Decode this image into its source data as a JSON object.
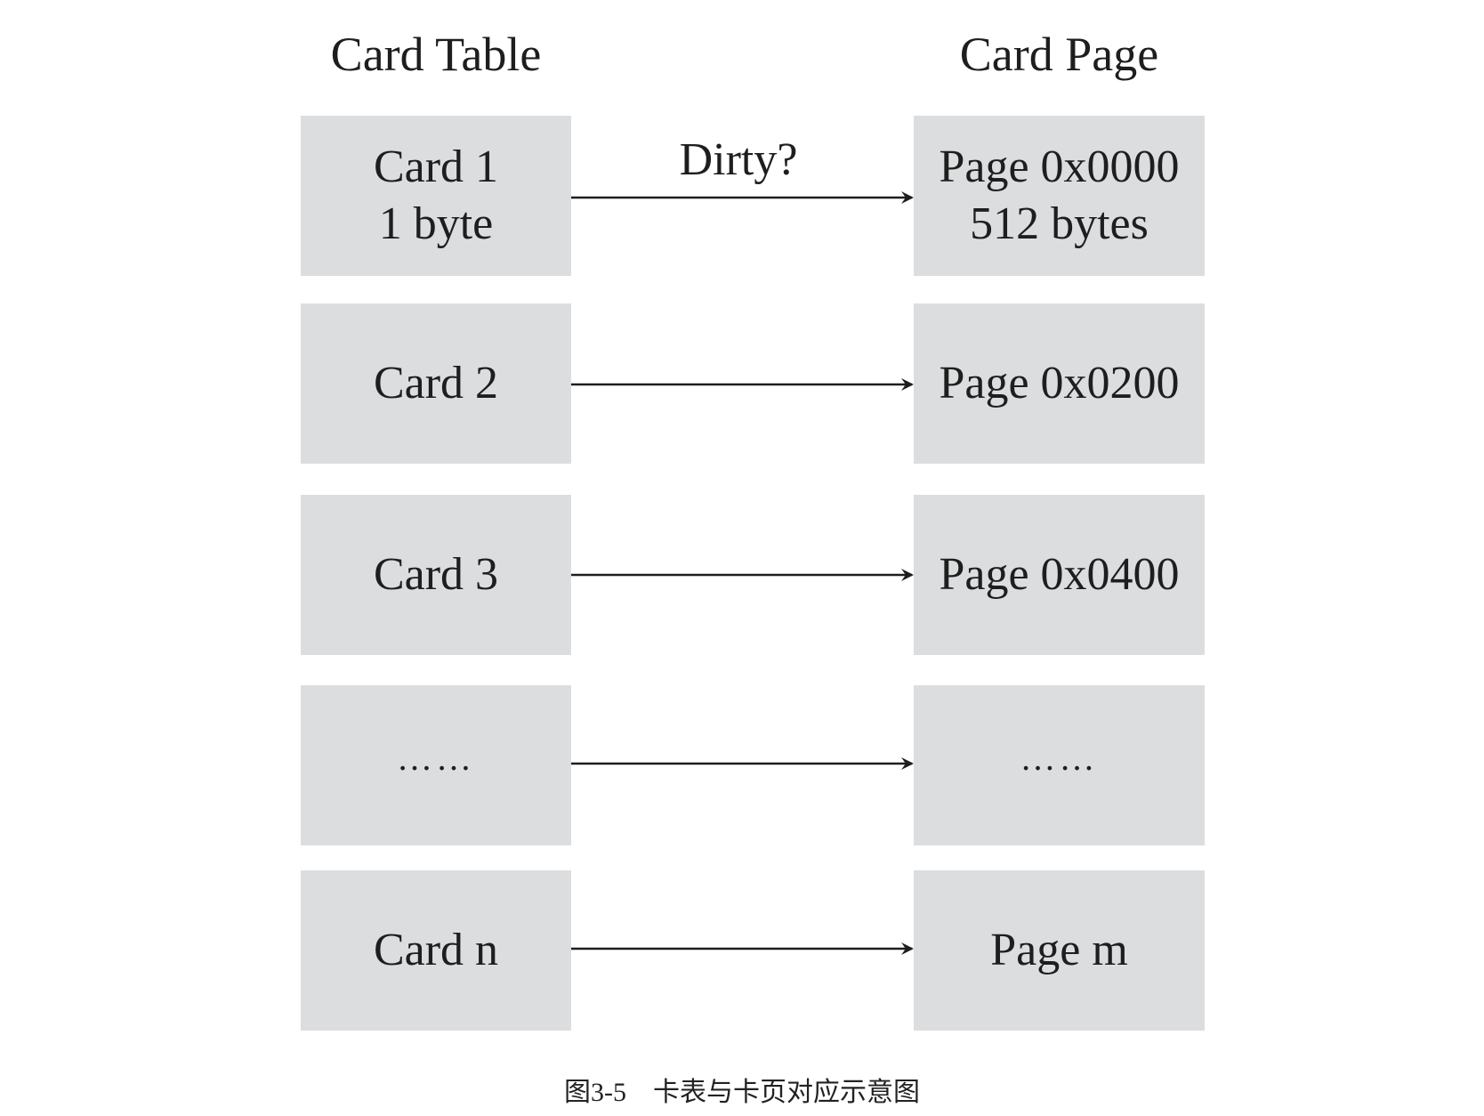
{
  "headers": {
    "left": "Card Table",
    "right": "Card Page"
  },
  "rows": [
    {
      "card_line1": "Card 1",
      "card_line2": "1 byte",
      "page_line1": "Page 0x0000",
      "page_line2": "512 bytes"
    },
    {
      "card_line1": "Card 2",
      "card_line2": "",
      "page_line1": "Page 0x0200",
      "page_line2": ""
    },
    {
      "card_line1": "Card 3",
      "card_line2": "",
      "page_line1": "Page 0x0400",
      "page_line2": ""
    },
    {
      "card_line1": "……",
      "card_line2": "",
      "page_line1": "……",
      "page_line2": ""
    },
    {
      "card_line1": "Card n",
      "card_line2": "",
      "page_line1": "Page m",
      "page_line2": ""
    }
  ],
  "arrow_label": "Dirty?",
  "caption": "图3-5    卡表与卡页对应示意图",
  "colors": {
    "box_fill": "#dcdddf",
    "text": "#1e1e1e",
    "arrow": "#1e1e1e"
  }
}
